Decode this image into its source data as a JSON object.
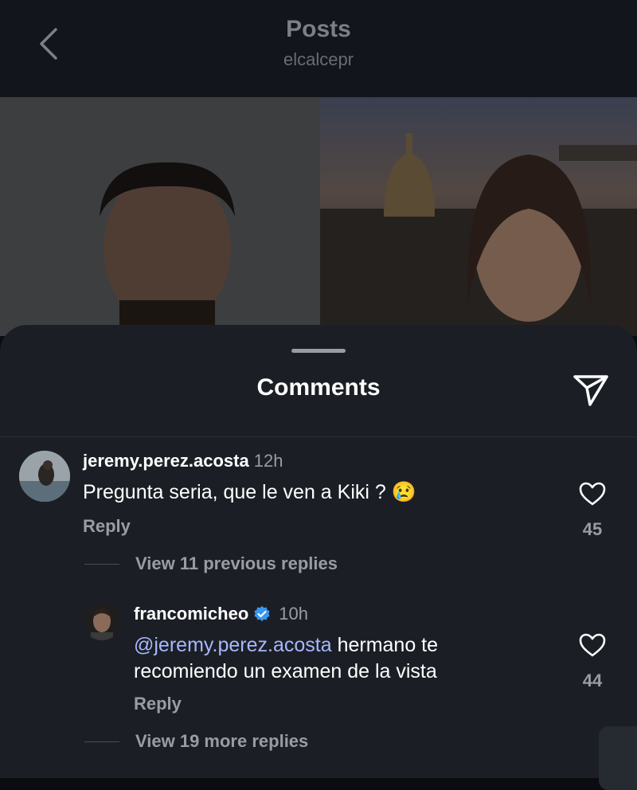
{
  "header": {
    "title": "Posts",
    "subtitle": "elcalcepr"
  },
  "sheet": {
    "title": "Comments"
  },
  "comments": [
    {
      "username": "jeremy.perez.acosta",
      "time": "12h",
      "text": "Pregunta seria, que le ven a Kiki ?",
      "emoji": "😢",
      "reply_label": "Reply",
      "likes": "45",
      "view_replies": "View 11 previous replies"
    },
    {
      "username": "francomicheo",
      "verified": true,
      "time": "10h",
      "mention": "@jeremy.perez.acosta",
      "text_line1": " hermano te",
      "text_line2": "recomiendo un examen de la vista",
      "reply_label": "Reply",
      "likes": "44",
      "view_replies": "View 19 more replies"
    }
  ],
  "colors": {
    "accent_mention": "#a6b7ff",
    "verified": "#3897f0",
    "sheet_bg": "#1b1f25"
  },
  "icons": [
    "back-chevron-icon",
    "share-icon",
    "heart-icon",
    "verified-badge-icon"
  ]
}
